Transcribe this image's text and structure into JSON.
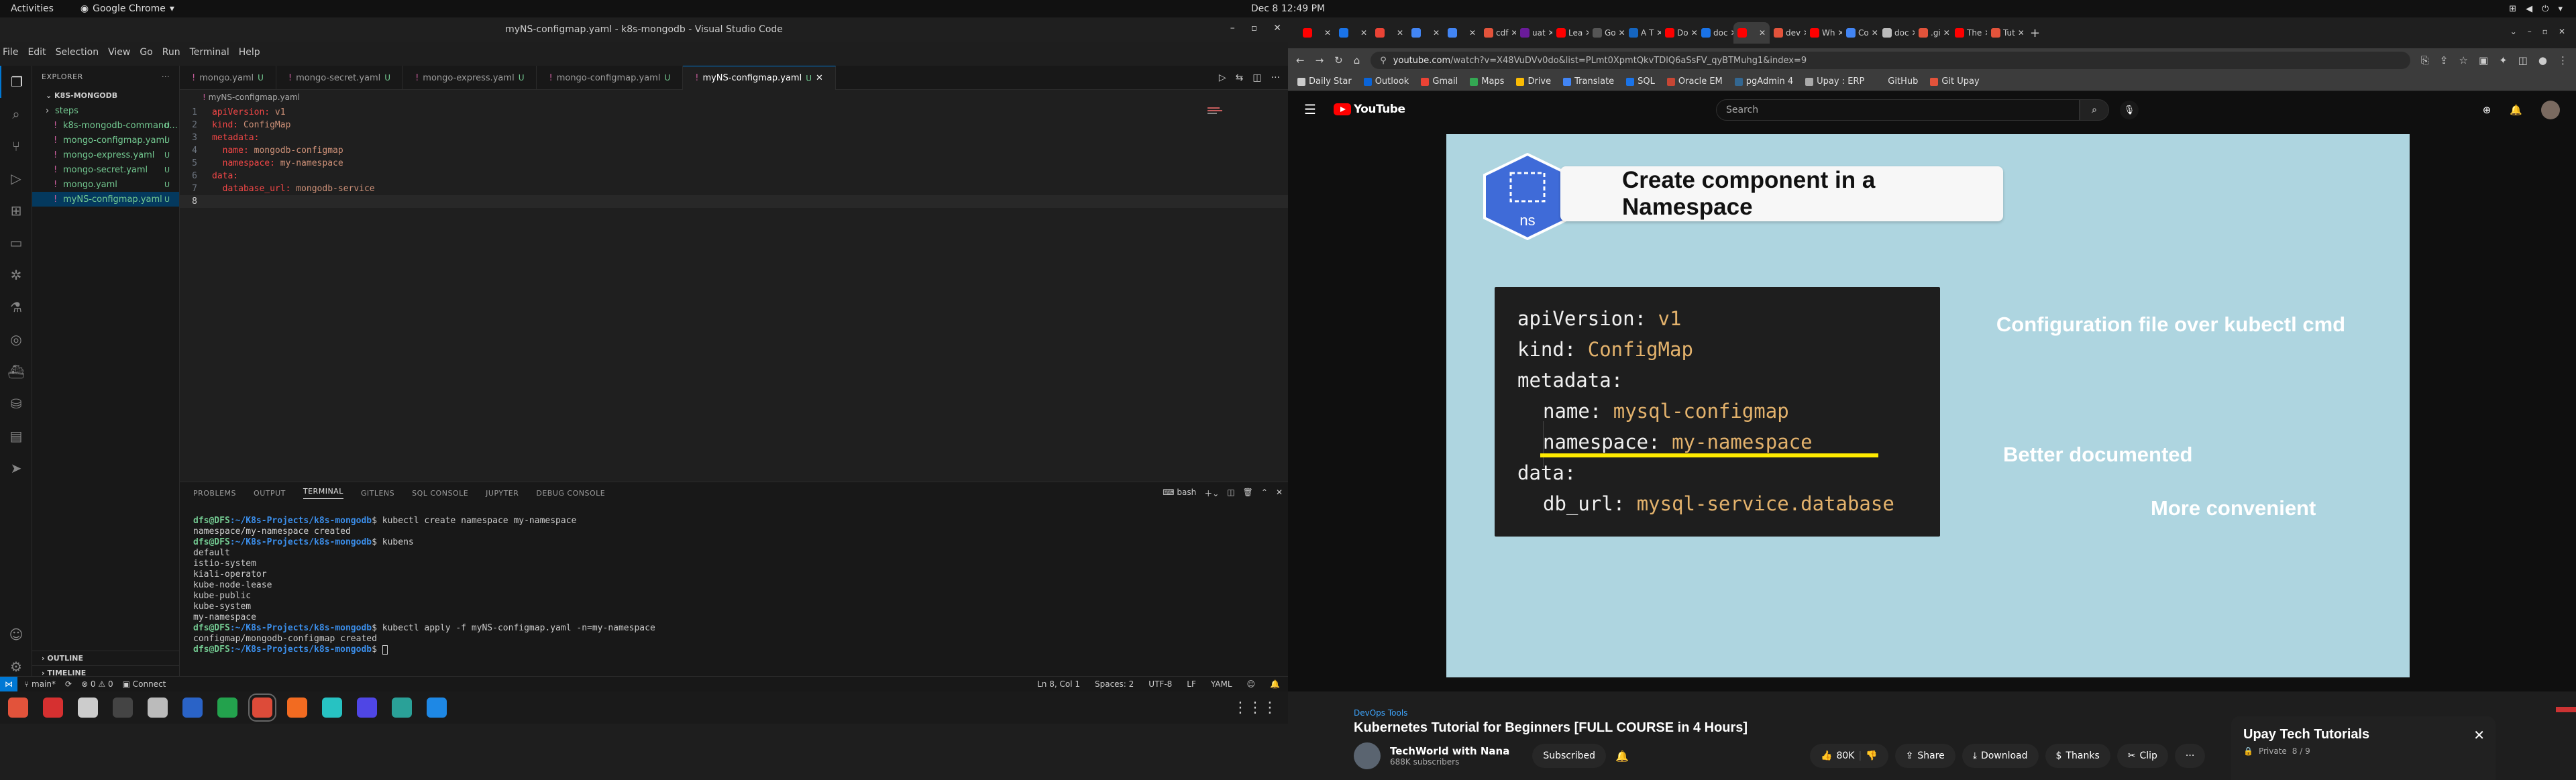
{
  "system": {
    "activities": "Activities",
    "app_name": "Google Chrome",
    "clock": "Dec 8  12:49 PM"
  },
  "vscode": {
    "title": "myNS-configmap.yaml - k8s-mongodb - Visual Studio Code",
    "menu": [
      "File",
      "Edit",
      "Selection",
      "View",
      "Go",
      "Run",
      "Terminal",
      "Help"
    ],
    "explorer_label": "EXPLORER",
    "project": "K8S-MONGODB",
    "files": [
      {
        "name": "steps",
        "badge": "",
        "modified": true
      },
      {
        "name": "k8s-mongodb-command...",
        "badge": "U",
        "modified": true
      },
      {
        "name": "mongo-configmap.yaml",
        "badge": "U",
        "modified": true
      },
      {
        "name": "mongo-express.yaml",
        "badge": "U",
        "modified": true
      },
      {
        "name": "mongo-secret.yaml",
        "badge": "U",
        "modified": true
      },
      {
        "name": "mongo.yaml",
        "badge": "U",
        "modified": true
      },
      {
        "name": "myNS-configmap.yaml",
        "badge": "U",
        "modified": true
      }
    ],
    "outline": "OUTLINE",
    "timeline": "TIMELINE",
    "tabs": [
      {
        "label": "mongo.yaml",
        "m": "U"
      },
      {
        "label": "mongo-secret.yaml",
        "m": "U"
      },
      {
        "label": "mongo-express.yaml",
        "m": "U"
      },
      {
        "label": "mongo-configmap.yaml",
        "m": "U"
      },
      {
        "label": "myNS-configmap.yaml",
        "m": "U"
      }
    ],
    "breadcrumb": "myNS-configmap.yaml",
    "code_lines": [
      {
        "n": "1",
        "k": "apiVersion:",
        "v": " v1"
      },
      {
        "n": "2",
        "k": "kind:",
        "v": " ConfigMap"
      },
      {
        "n": "3",
        "k": "metadata:",
        "v": ""
      },
      {
        "n": "4",
        "k": "  name:",
        "v": " mongodb-configmap"
      },
      {
        "n": "5",
        "k": "  namespace:",
        "v": " my-namespace"
      },
      {
        "n": "6",
        "k": "data:",
        "v": ""
      },
      {
        "n": "7",
        "k": "  database_url:",
        "v": " mongodb-service"
      },
      {
        "n": "8",
        "k": "",
        "v": ""
      }
    ],
    "panel_tabs": [
      "PROBLEMS",
      "OUTPUT",
      "TERMINAL",
      "GITLENS",
      "SQL CONSOLE",
      "JUPYTER",
      "DEBUG CONSOLE"
    ],
    "shell": "bash",
    "terminal": [
      {
        "prompt": "dfs@DFS",
        "path": ":~/K8s-Projects/k8s-mongodb",
        "cmd": "$ kubectl create namespace my-namespace"
      },
      {
        "out": "namespace/my-namespace created"
      },
      {
        "prompt": "dfs@DFS",
        "path": ":~/K8s-Projects/k8s-mongodb",
        "cmd": "$ kubens"
      },
      {
        "out": "default"
      },
      {
        "out": "istio-system"
      },
      {
        "out": "kiali-operator"
      },
      {
        "out": "kube-node-lease"
      },
      {
        "out": "kube-public"
      },
      {
        "out": "kube-system"
      },
      {
        "out": "my-namespace"
      },
      {
        "prompt": "dfs@DFS",
        "path": ":~/K8s-Projects/k8s-mongodb",
        "cmd": "$ kubectl apply -f myNS-configmap.yaml -n=my-namespace"
      },
      {
        "out": "configmap/mongodb-configmap created"
      },
      {
        "prompt": "dfs@DFS",
        "path": ":~/K8s-Projects/k8s-mongodb",
        "cmd": "$ "
      }
    ],
    "status": {
      "branch": "main*",
      "problems": "⊗ 0 ⚠ 0",
      "connect": "Connect",
      "cursor": "Ln 8, Col 1",
      "spaces": "Spaces: 2",
      "encoding": "UTF-8",
      "eol": "LF",
      "lang": "YAML"
    }
  },
  "chrome": {
    "tabs": [
      {
        "t": "",
        "c": "#ff0000"
      },
      {
        "t": "",
        "c": "#1a73e8"
      },
      {
        "t": "",
        "c": "#ea4335"
      },
      {
        "t": "",
        "c": "#4285f4"
      },
      {
        "t": "",
        "c": "#4285f4"
      },
      {
        "t": "cdf",
        "c": "#e2533b"
      },
      {
        "t": "uat",
        "c": "#6a1b9a"
      },
      {
        "t": "Lea",
        "c": "#ff0000"
      },
      {
        "t": "Go",
        "c": "#555555"
      },
      {
        "t": "A T",
        "c": "#1565c0"
      },
      {
        "t": "Do",
        "c": "#ff0000"
      },
      {
        "t": "doc",
        "c": "#1a73e8"
      },
      {
        "t": "",
        "c": "#ff0000"
      },
      {
        "t": "dev",
        "c": "#e2533b"
      },
      {
        "t": "Wh",
        "c": "#ff0000"
      },
      {
        "t": "Co",
        "c": "#4285f4"
      },
      {
        "t": "doc",
        "c": "#bbbbbb"
      },
      {
        "t": ".gi",
        "c": "#e2533b"
      },
      {
        "t": "The",
        "c": "#ff0000"
      },
      {
        "t": "Tut",
        "c": "#e2533b"
      }
    ],
    "url_host": "youtube.com",
    "url_rest": "/watch?v=X48VuDVv0do&list=PLmt0XpmtQkvTDlQ6aSsFV_qyBTMuhg1&index=9",
    "bookmarks": [
      {
        "t": "Daily Star",
        "c": "#cccccc"
      },
      {
        "t": "Outlook",
        "c": "#0a64d8"
      },
      {
        "t": "Gmail",
        "c": "#ea4335"
      },
      {
        "t": "Maps",
        "c": "#34a853"
      },
      {
        "t": "Drive",
        "c": "#fbbc04"
      },
      {
        "t": "Translate",
        "c": "#4285f4"
      },
      {
        "t": "SQL",
        "c": "#1a73e8"
      },
      {
        "t": "Oracle EM",
        "c": "#c74634"
      },
      {
        "t": "pgAdmin 4",
        "c": "#336791"
      },
      {
        "t": "Upay : ERP",
        "c": "#aaaaaa"
      },
      {
        "t": "GitHub",
        "c": "#3c3c3c"
      },
      {
        "t": "Git Upay",
        "c": "#e2533b"
      }
    ],
    "yt_logo": "YouTube",
    "search_placeholder": "Search",
    "video": {
      "ns_label": "ns",
      "title": "Create component in a Namespace",
      "code": [
        {
          "k": "apiVersion",
          "v": "v1",
          "ind": false
        },
        {
          "k": "kind",
          "v": "ConfigMap",
          "ind": false
        },
        {
          "k": "metadata",
          "v": "",
          "ind": false
        },
        {
          "k": "name",
          "v": "mysql-configmap",
          "ind": true
        },
        {
          "k": "namespace",
          "v": "my-namespace",
          "ind": true
        },
        {
          "k": "data",
          "v": "",
          "ind": false
        },
        {
          "k": "db_url",
          "v": "mysql-service.database",
          "ind": true
        }
      ],
      "side1": "Configuration file over kubectl cmd",
      "side2": "Better documented",
      "side3": "More convenient"
    },
    "info": {
      "tag": "DevOps Tools",
      "title": "Kubernetes Tutorial for Beginners [FULL COURSE in 4 Hours]",
      "channel": "TechWorld with Nana",
      "subs": "688K subscribers",
      "subscribed": "Subscribed",
      "likes": "80K",
      "share": "Share",
      "download": "Download",
      "thanks": "Thanks",
      "clip": "Clip"
    },
    "playlist": {
      "title": "Upay Tech Tutorials",
      "private": "Private",
      "count": "8 / 9"
    }
  },
  "dock": [
    "#e2533b",
    "#d63030",
    "#cccccc",
    "#444444",
    "#bbbbbb",
    "#2a63c7",
    "#23a24d",
    "#dd4b39",
    "#f26b21",
    "#27c2c2",
    "#4f46e5",
    "#2aa198",
    "#1e88e5"
  ]
}
